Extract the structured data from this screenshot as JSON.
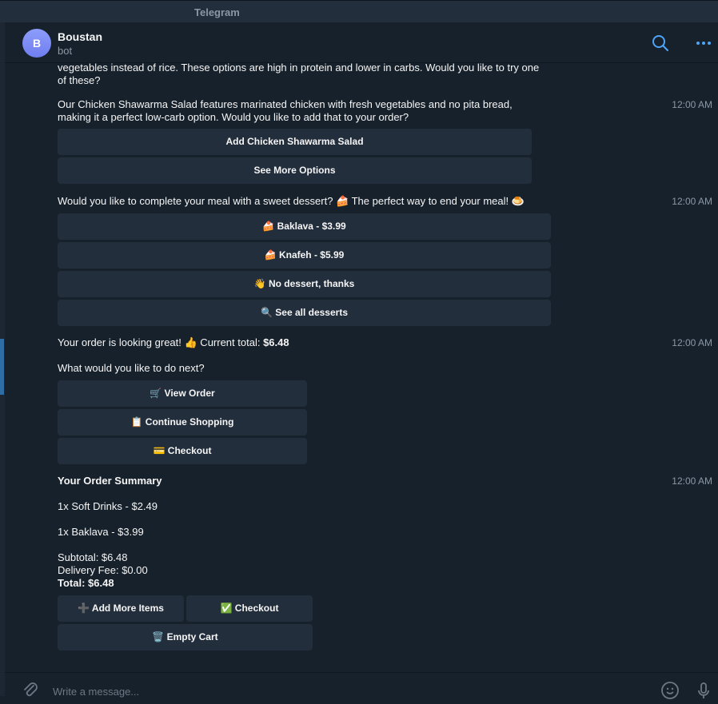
{
  "window": {
    "title": "Telegram"
  },
  "header": {
    "avatar_letter": "B",
    "name": "Boustan",
    "status": "bot"
  },
  "messages": {
    "m0": {
      "line1": "vegetables instead of rice. These options are high in protein and lower in carbs. Would you like to try one",
      "line2": "of these?"
    },
    "m1": {
      "line1": "Our Chicken Shawarma Salad features marinated chicken with fresh vegetables and no pita bread,",
      "line2": "making it a perfect low-carb option. Would you like to add that to your order?",
      "time": "12:00 AM",
      "buttons": [
        "Add Chicken Shawarma Salad",
        "See More Options"
      ]
    },
    "m2": {
      "text": "Would you like to complete your meal with a sweet dessert? 🍰 The perfect way to end your meal! 🍮",
      "time": "12:00 AM",
      "buttons": [
        "🍰 Baklava - $3.99",
        "🍰 Knafeh - $5.99",
        "👋 No dessert, thanks",
        "🔍 See all desserts"
      ]
    },
    "m3": {
      "text_prefix": "Your order is looking great! 👍 Current total: ",
      "total": "$6.48",
      "next": "What would you like to do next?",
      "time": "12:00 AM",
      "buttons": [
        "🛒 View Order",
        "📋 Continue Shopping",
        "💳 Checkout"
      ]
    },
    "m4": {
      "title": "Your Order Summary",
      "item1": "1x Soft Drinks - $2.49",
      "item2": "1x Baklava - $3.99",
      "subtotal": "Subtotal: $6.48",
      "delivery": "Delivery Fee: $0.00",
      "total": "Total: $6.48",
      "time": "12:00 AM",
      "buttons": [
        "➕ Add More Items",
        "✅ Checkout",
        "🗑️ Empty Cart"
      ]
    }
  },
  "composer": {
    "placeholder": "Write a message..."
  },
  "colors": {
    "accent": "#4ea4f6",
    "background": "#17212b",
    "button": "#232e3c"
  },
  "icons": [
    "search-icon",
    "more-icon",
    "attach-icon",
    "emoji-icon",
    "microphone-icon"
  ]
}
